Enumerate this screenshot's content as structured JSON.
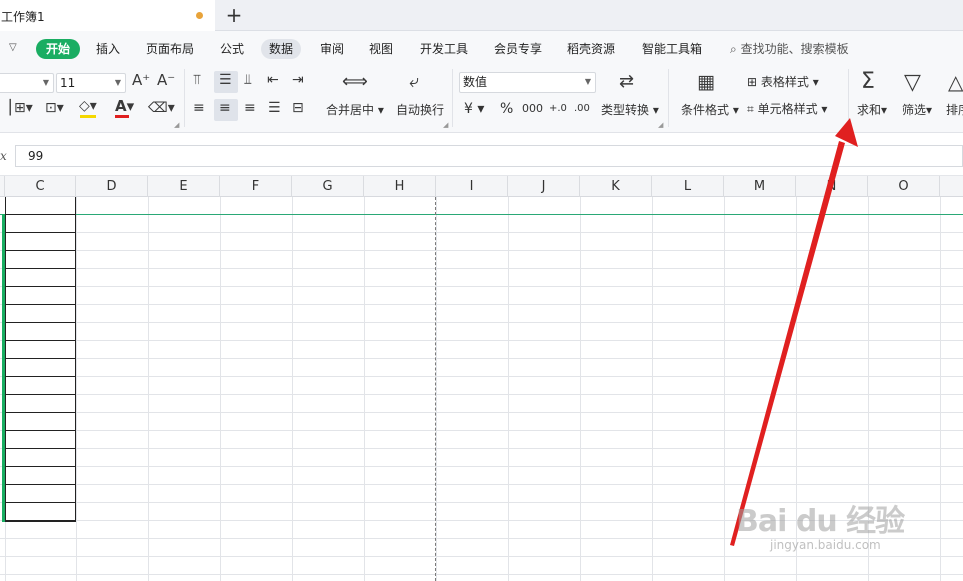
{
  "title_bar": {
    "doc_name": "工作簿1",
    "new_tab_icon": "+"
  },
  "menu": {
    "collapse_icon": "chevron-down-icon",
    "items": [
      "开始",
      "插入",
      "页面布局",
      "公式",
      "数据",
      "审阅",
      "视图",
      "开发工具",
      "会员专享",
      "稻壳资源",
      "智能工具箱"
    ],
    "search_label": "查找功能、搜索模板"
  },
  "ribbon": {
    "font_size": "11",
    "number_format": "数值",
    "merge_label": "合并居中",
    "wrap_label": "自动换行",
    "type_convert_label": "类型转换",
    "cond_format_label": "条件格式",
    "table_style_label": "表格样式",
    "cell_style_label": "单元格样式",
    "sum_label": "求和",
    "filter_label": "筛选",
    "sort_label": "排序",
    "currency_symbol": "¥",
    "percent_symbol": "%",
    "thousands_symbol": "000",
    "inc_decimal_symbol": "+.0",
    "dec_decimal_symbol": ".00",
    "font_color": "#e02020",
    "fill_color": "#f5d800"
  },
  "formula": {
    "fx": "x",
    "value": "99"
  },
  "grid": {
    "columns": [
      "C",
      "D",
      "E",
      "F",
      "G",
      "H",
      "I",
      "J",
      "K",
      "L",
      "M",
      "N",
      "O"
    ]
  },
  "watermark": {
    "logo": "Bai du 经验",
    "url": "jingyan.baidu.com"
  },
  "colors": {
    "accent_green": "#1aad62",
    "arrow_red": "#e02020"
  }
}
